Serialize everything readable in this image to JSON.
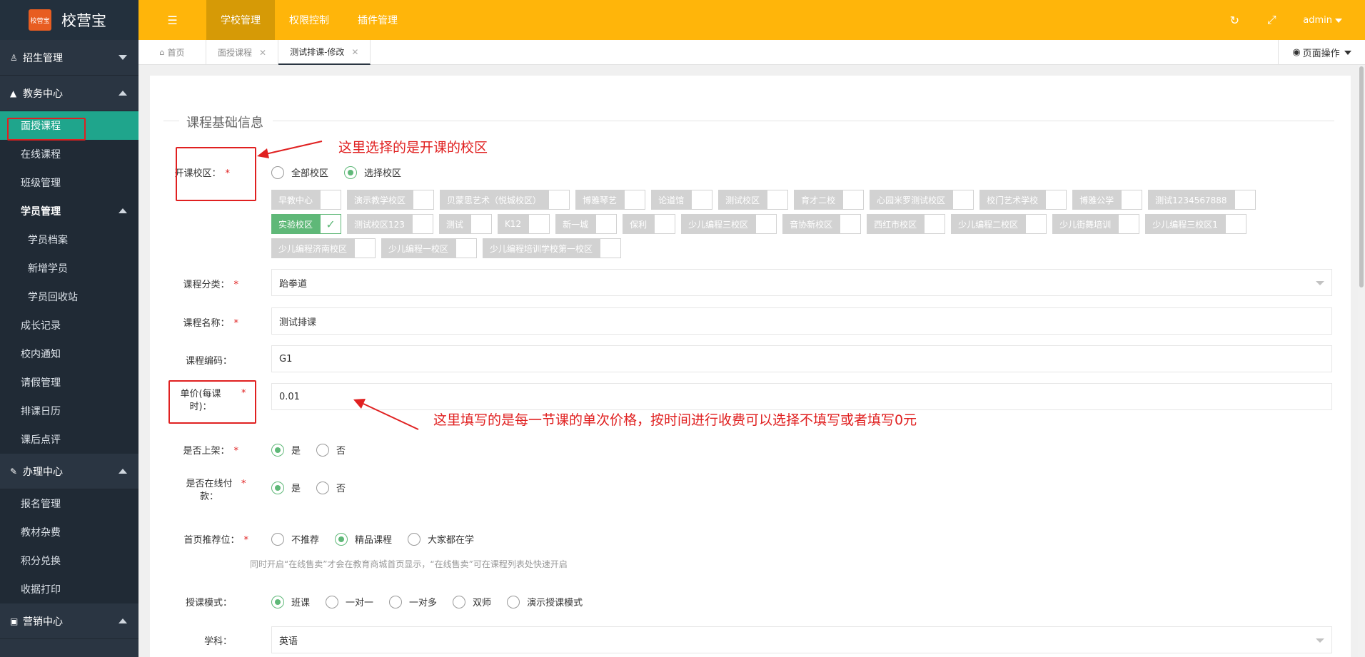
{
  "app": {
    "logo_badge": "校营宝",
    "title": "校营宝"
  },
  "sidebar": {
    "groups": [
      {
        "label": "招生管理",
        "icon": "user-icon"
      },
      {
        "label": "教务中心",
        "icon": "graduation-cap-icon"
      },
      {
        "label": "办理中心",
        "icon": "edit-icon"
      },
      {
        "label": "营销中心",
        "icon": "monitor-icon"
      }
    ],
    "edu_items": [
      "面授课程",
      "在线课程",
      "班级管理",
      "学员管理",
      "学员档案",
      "新增学员",
      "学员回收站",
      "成长记录",
      "校内通知",
      "请假管理",
      "排课日历",
      "课后点评"
    ],
    "office_items": [
      "报名管理",
      "教材杂费",
      "积分兑换",
      "收据打印"
    ]
  },
  "topbar": {
    "nav": [
      "学校管理",
      "权限控制",
      "插件管理"
    ],
    "user": "admin"
  },
  "tabs": [
    {
      "label": "首页"
    },
    {
      "label": "面授课程"
    },
    {
      "label": "测试排课-修改"
    }
  ],
  "page_ops": "页面操作",
  "form": {
    "section_title": "课程基础信息",
    "campus": {
      "label": "开课校区：",
      "options": [
        "全部校区",
        "选择校区"
      ],
      "chips": [
        "早教中心",
        "演示教学校区",
        "贝蒙思艺术（悦城校区）",
        "博雅琴艺",
        "论道馆",
        "测试校区",
        "育才二校",
        "心园米罗测试校区",
        "校门艺术学校",
        "博雅公学",
        "测试1234567888",
        "实验校区",
        "测试校区123",
        "测试",
        "K12",
        "新一城",
        "保利",
        "少儿编程三校区",
        "音协新校区",
        "西红市校区",
        "少儿编程二校区",
        "少儿街舞培训",
        "少儿编程三校区1",
        "少儿编程济南校区",
        "少儿编程一校区",
        "少儿编程培训学校第一校区"
      ]
    },
    "category": {
      "label": "课程分类：",
      "value": "跆拳道"
    },
    "name": {
      "label": "课程名称：",
      "value": "测试排课"
    },
    "code": {
      "label": "课程编码：",
      "value": "G1"
    },
    "price": {
      "label_line1": "单价(每课",
      "label_line2": "时)：",
      "value": "0.01"
    },
    "on_shelf": {
      "label": "是否上架：",
      "options": [
        "是",
        "否"
      ]
    },
    "online_pay": {
      "label_line1": "是否在线付",
      "label_line2": "款：",
      "options": [
        "是",
        "否"
      ]
    },
    "recommend": {
      "label": "首页推荐位：",
      "options": [
        "不推荐",
        "精品课程",
        "大家都在学"
      ],
      "hint": "同时开启“在线售卖”才会在教育商城首页显示，“在线售卖”可在课程列表处快速开启"
    },
    "mode": {
      "label": "授课模式：",
      "options": [
        "班课",
        "一对一",
        "一对多",
        "双师",
        "演示授课模式"
      ]
    },
    "subject": {
      "label": "学科：",
      "value": "英语"
    },
    "required_mark": "*"
  },
  "annotations": {
    "campus_note": "这里选择的是开课的校区",
    "price_note": "这里填写的是每一节课的单次价格，按时间进行收费可以选择不填写或者填写0元"
  },
  "colors": {
    "topbar": "#ffb50a",
    "sidebar": "#2a3542",
    "active_menu": "#1fa58c",
    "checked": "#5fb878",
    "annotation": "#e02020"
  }
}
